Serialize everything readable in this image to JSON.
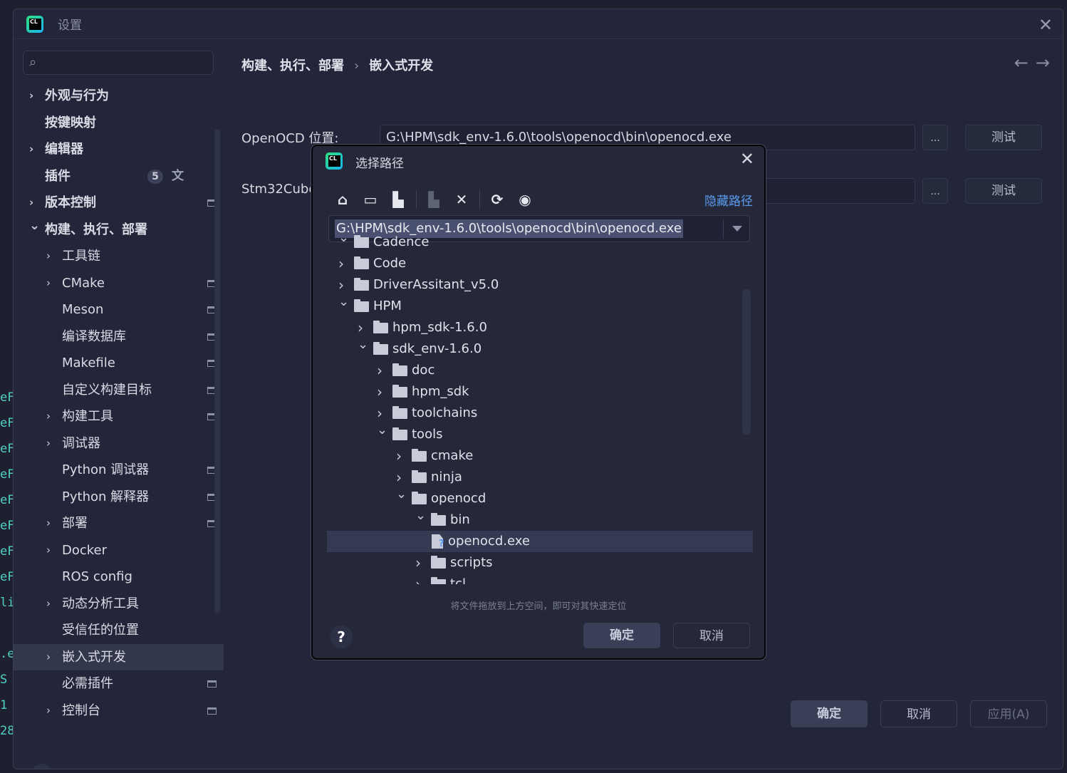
{
  "window": {
    "title": "设置"
  },
  "sidebar": {
    "items": [
      {
        "label": "外观与行为",
        "level": 0,
        "bold": true,
        "chevron": ">"
      },
      {
        "label": "按键映射",
        "level": 0,
        "bold": true,
        "chevron": ""
      },
      {
        "label": "编辑器",
        "level": 0,
        "bold": true,
        "chevron": ">"
      },
      {
        "label": "插件",
        "level": 0,
        "bold": true,
        "chevron": "",
        "badge": "5"
      },
      {
        "label": "版本控制",
        "level": 0,
        "bold": true,
        "chevron": ">",
        "project": true
      },
      {
        "label": "构建、执行、部署",
        "level": 0,
        "bold": true,
        "chevron": "v"
      },
      {
        "label": "工具链",
        "level": 1,
        "chevron": ">"
      },
      {
        "label": "CMake",
        "level": 1,
        "chevron": ">",
        "project": true
      },
      {
        "label": "Meson",
        "level": 1,
        "chevron": "",
        "project": true
      },
      {
        "label": "编译数据库",
        "level": 1,
        "chevron": "",
        "project": true
      },
      {
        "label": "Makefile",
        "level": 1,
        "chevron": "",
        "project": true
      },
      {
        "label": "自定义构建目标",
        "level": 1,
        "chevron": "",
        "project": true
      },
      {
        "label": "构建工具",
        "level": 1,
        "chevron": ">",
        "project": true
      },
      {
        "label": "调试器",
        "level": 1,
        "chevron": ">"
      },
      {
        "label": "Python 调试器",
        "level": 1,
        "chevron": "",
        "project": true
      },
      {
        "label": "Python 解释器",
        "level": 1,
        "chevron": "",
        "project": true
      },
      {
        "label": "部署",
        "level": 1,
        "chevron": ">",
        "project": true
      },
      {
        "label": "Docker",
        "level": 1,
        "chevron": ">"
      },
      {
        "label": "ROS config",
        "level": 1,
        "chevron": ""
      },
      {
        "label": "动态分析工具",
        "level": 1,
        "chevron": ">"
      },
      {
        "label": "受信任的位置",
        "level": 1,
        "chevron": ""
      },
      {
        "label": "嵌入式开发",
        "level": 1,
        "chevron": ">",
        "selected": true
      },
      {
        "label": "必需插件",
        "level": 1,
        "chevron": "",
        "project": true
      },
      {
        "label": "控制台",
        "level": 1,
        "chevron": ">",
        "project": true
      }
    ]
  },
  "content": {
    "breadcrumb": [
      "构建、执行、部署",
      "嵌入式开发"
    ],
    "fields": [
      {
        "label": "OpenOCD 位置:",
        "value": "G:\\HPM\\sdk_env-1.6.0\\tools\\openocd\\bin\\openocd.exe",
        "browse": "...",
        "test": "测试"
      },
      {
        "label": "Stm32Cube",
        "value": "",
        "browse": "...",
        "test": "测试"
      }
    ]
  },
  "footer": {
    "ok": "确定",
    "cancel": "取消",
    "apply": "应用(A)",
    "help": "?"
  },
  "dialog": {
    "title": "选择路径",
    "hide_path": "隐藏路径",
    "path": "G:\\HPM\\sdk_env-1.6.0\\tools\\openocd\\bin\\openocd.exe",
    "tree": [
      {
        "label": "Cadence",
        "depth": 0,
        "chevron": "v",
        "type": "folder"
      },
      {
        "label": "Code",
        "depth": 0,
        "chevron": ">",
        "type": "folder"
      },
      {
        "label": "DriverAssitant_v5.0",
        "depth": 0,
        "chevron": ">",
        "type": "folder"
      },
      {
        "label": "HPM",
        "depth": 0,
        "chevron": "v",
        "type": "folder"
      },
      {
        "label": "hpm_sdk-1.6.0",
        "depth": 1,
        "chevron": ">",
        "type": "folder"
      },
      {
        "label": "sdk_env-1.6.0",
        "depth": 1,
        "chevron": "v",
        "type": "folder"
      },
      {
        "label": "doc",
        "depth": 2,
        "chevron": ">",
        "type": "folder"
      },
      {
        "label": "hpm_sdk",
        "depth": 2,
        "chevron": ">",
        "type": "folder"
      },
      {
        "label": "toolchains",
        "depth": 2,
        "chevron": ">",
        "type": "folder"
      },
      {
        "label": "tools",
        "depth": 2,
        "chevron": "v",
        "type": "folder"
      },
      {
        "label": "cmake",
        "depth": 3,
        "chevron": ">",
        "type": "folder"
      },
      {
        "label": "ninja",
        "depth": 3,
        "chevron": ">",
        "type": "folder"
      },
      {
        "label": "openocd",
        "depth": 3,
        "chevron": "v",
        "type": "folder"
      },
      {
        "label": "bin",
        "depth": 4,
        "chevron": "v",
        "type": "folder"
      },
      {
        "label": "openocd.exe",
        "depth": 5,
        "chevron": "",
        "type": "file",
        "selected": true
      },
      {
        "label": "scripts",
        "depth": 4,
        "chevron": ">",
        "type": "folder"
      },
      {
        "label": "tcl",
        "depth": 4,
        "chevron": ">",
        "type": "folder"
      }
    ],
    "drop_hint": "将文件拖放到上方空间，即可对其快速定位",
    "ok": "确定",
    "cancel": "取消",
    "help": "?"
  },
  "background_gutter": [
    "eF",
    "eF",
    "eF",
    "eF",
    "eF",
    "eF",
    "eF",
    "eF",
    "li",
    "",
    ".e",
    "S",
    "1",
    "28"
  ]
}
